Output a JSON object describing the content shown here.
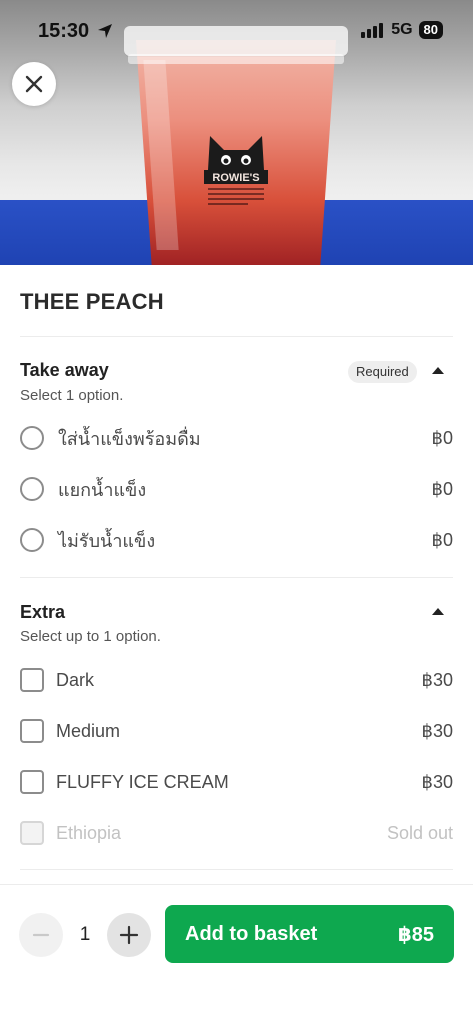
{
  "status_bar": {
    "time": "15:30",
    "network": "5G",
    "battery": "80"
  },
  "hero": {
    "logo_text": "ROWIE'S"
  },
  "product": {
    "title": "THEE PEACH"
  },
  "sections": [
    {
      "title": "Take away",
      "badge": "Required",
      "subtitle": "Select 1 option.",
      "options": [
        {
          "label": "ใส่น้ำแข็งพร้อมดื่ม",
          "price": "฿0"
        },
        {
          "label": "แยกน้ำแข็ง",
          "price": "฿0"
        },
        {
          "label": "ไม่รับน้ำแข็ง",
          "price": "฿0"
        }
      ]
    },
    {
      "title": "Extra",
      "subtitle": "Select up to 1 option.",
      "options": [
        {
          "label": "Dark",
          "price": "฿30"
        },
        {
          "label": "Medium",
          "price": "฿30"
        },
        {
          "label": "FLUFFY ICE CREAM",
          "price": "฿30"
        },
        {
          "label": "Ethiopia",
          "price": "Sold out",
          "disabled": true
        }
      ]
    }
  ],
  "footer": {
    "quantity": "1",
    "add_label": "Add to basket",
    "total": "฿85"
  },
  "colors": {
    "accent": "#0ea84f",
    "hero_blue": "#2a51c6"
  }
}
